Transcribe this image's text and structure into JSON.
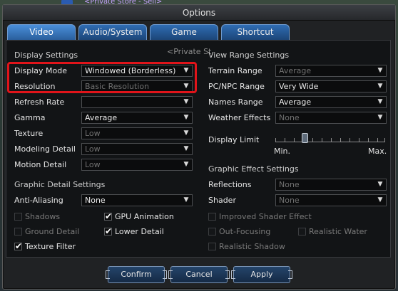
{
  "background": {
    "store_text": "<Private Store - Sell>",
    "store_text_mid": "<Private St"
  },
  "window": {
    "title": "Options"
  },
  "tabs": [
    {
      "label": "Video",
      "active": true
    },
    {
      "label": "Audio/System",
      "active": false
    },
    {
      "label": "Game",
      "active": false
    },
    {
      "label": "Shortcut",
      "active": false
    }
  ],
  "display_settings": {
    "title": "Display Settings",
    "display_mode": {
      "label": "Display Mode",
      "value": "Windowed (Borderless)"
    },
    "resolution": {
      "label": "Resolution",
      "value": "Basic Resolution"
    },
    "refresh_rate": {
      "label": "Refresh Rate",
      "value": ""
    },
    "gamma": {
      "label": "Gamma",
      "value": "Average"
    },
    "texture": {
      "label": "Texture",
      "value": "Low"
    },
    "modeling_detail": {
      "label": "Modeling Detail",
      "value": "Low"
    },
    "motion_detail": {
      "label": "Motion Detail",
      "value": "Low"
    }
  },
  "graphic_detail": {
    "title": "Graphic Detail Settings",
    "anti_aliasing": {
      "label": "Anti-Aliasing",
      "value": "None"
    },
    "shadows": {
      "label": "Shadows",
      "checked": false,
      "enabled": false
    },
    "gpu_animation": {
      "label": "GPU Animation",
      "checked": true
    },
    "ground_detail": {
      "label": "Ground Detail",
      "checked": false,
      "enabled": false
    },
    "lower_detail": {
      "label": "Lower Detail",
      "checked": true
    },
    "texture_filter": {
      "label": "Texture Filter",
      "checked": true
    }
  },
  "view_range": {
    "title": "View Range Settings",
    "terrain_range": {
      "label": "Terrain Range",
      "value": "Average"
    },
    "pc_npc_range": {
      "label": "PC/NPC Range",
      "value": "Very Wide"
    },
    "names_range": {
      "label": "Names Range",
      "value": "Average"
    },
    "weather_effects": {
      "label": "Weather Effects",
      "value": "None"
    },
    "display_limit": {
      "label": "Display Limit",
      "min": "Min.",
      "max": "Max.",
      "level": 0.27
    }
  },
  "graphic_effect": {
    "title": "Graphic Effect Settings",
    "reflections": {
      "label": "Reflections",
      "value": "None"
    },
    "shader": {
      "label": "Shader",
      "value": "None"
    },
    "improved_shader": {
      "label": "Improved Shader Effect",
      "checked": false,
      "enabled": false
    },
    "out_focusing": {
      "label": "Out-Focusing",
      "checked": false,
      "enabled": false
    },
    "realistic_water": {
      "label": "Realistic Water",
      "checked": false,
      "enabled": false
    },
    "realistic_shadow": {
      "label": "Realistic Shadow",
      "checked": false,
      "enabled": false
    }
  },
  "buttons": {
    "confirm": "Confirm",
    "cancel": "Cancel",
    "apply": "Apply"
  },
  "icons": {
    "dropdown": "chevron-down-icon",
    "check": "checkmark-icon"
  },
  "colors": {
    "highlight": "#e0141a",
    "tab_active": "#4a8fda",
    "tab": "#2f6db3"
  }
}
